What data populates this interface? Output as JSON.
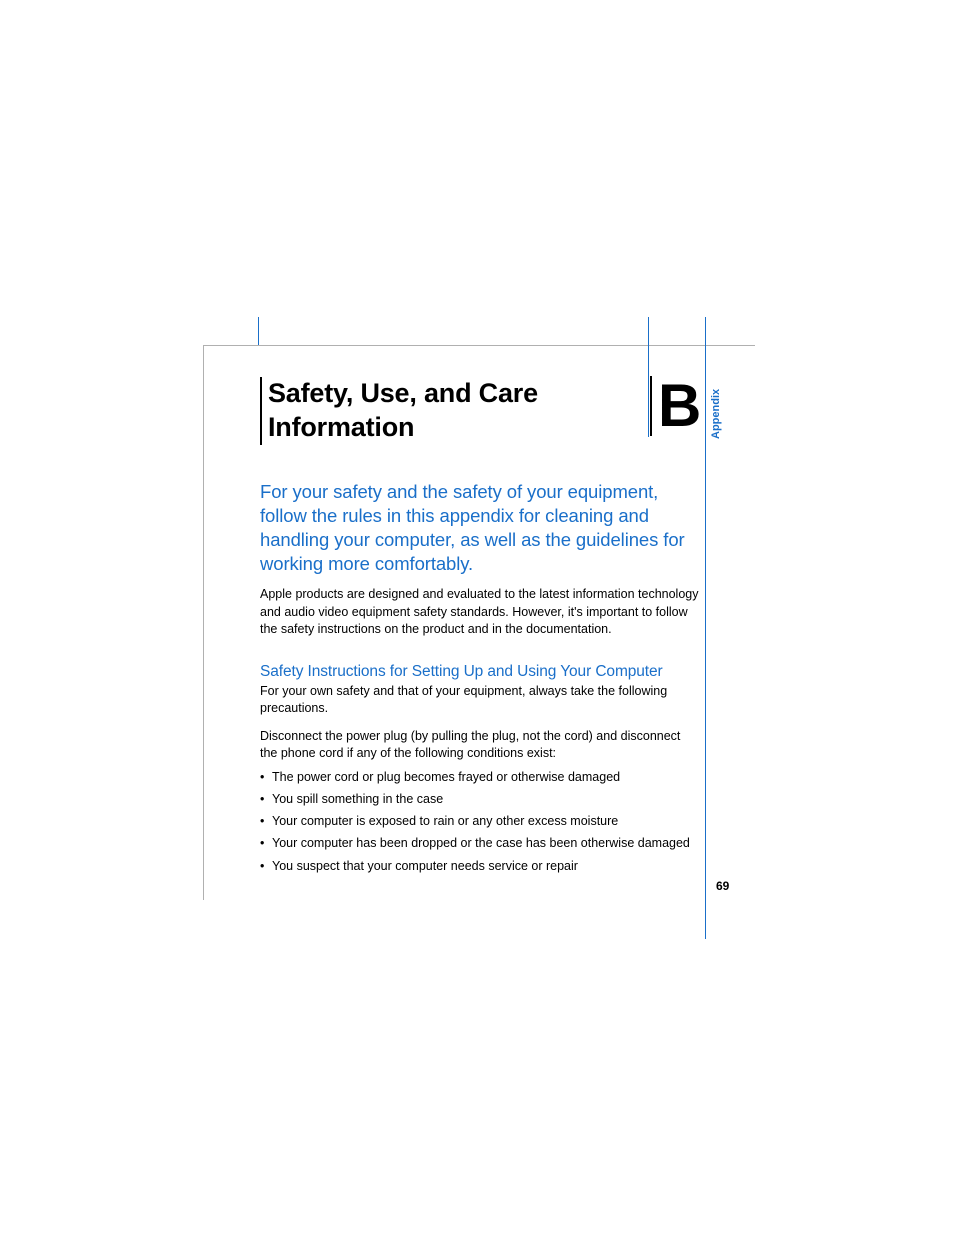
{
  "header": {
    "title": "Safety, Use, and Care Information",
    "appendix_letter": "B",
    "appendix_label": "Appendix"
  },
  "content": {
    "intro": "For your safety and the safety of your equipment, follow the rules in this appendix for cleaning and handling your computer, as well as the guidelines for working more comfortably.",
    "para1": "Apple products are designed and evaluated to the latest information technology and audio video equipment safety standards. However, it's important to follow the safety instructions on the product and in the documentation.",
    "section_heading": "Safety Instructions for Setting Up and Using Your Computer",
    "para2": "For your own safety and that of your equipment, always take the following precautions.",
    "para3": "Disconnect the power plug (by pulling the plug, not the cord) and disconnect the phone cord if any of the following conditions exist:",
    "bullets": [
      "The power cord or plug becomes frayed or otherwise damaged",
      "You spill something in the case",
      "Your computer is exposed to rain or any other excess moisture",
      "Your computer has been dropped or the case has been otherwise damaged",
      "You suspect that your computer needs service or repair"
    ]
  },
  "page_number": "69"
}
